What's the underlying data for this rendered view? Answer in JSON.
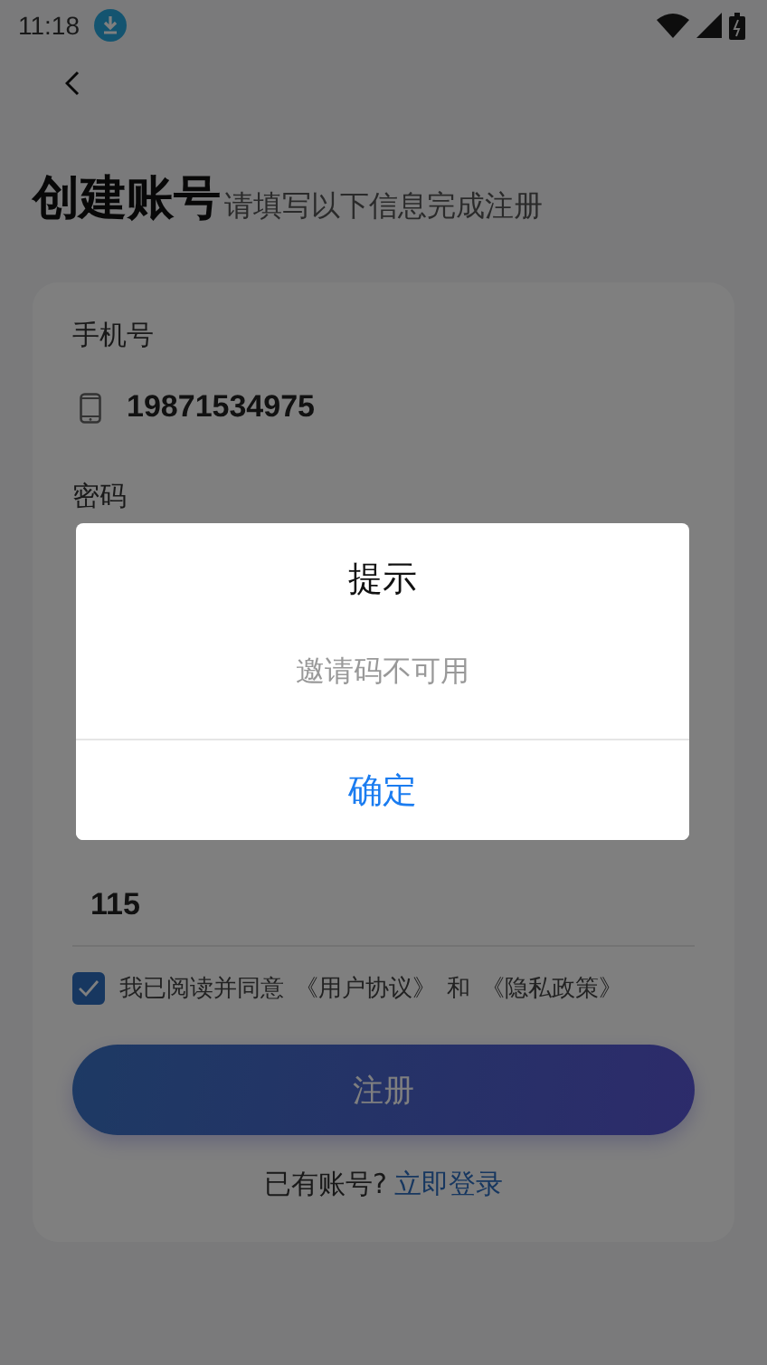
{
  "status_bar": {
    "time": "11:18"
  },
  "header": {
    "title": "创建账号",
    "subtitle": "请填写以下信息完成注册"
  },
  "form": {
    "phone_label": "手机号",
    "phone_value": "19871534975",
    "password_label": "密码",
    "invite_value": "115"
  },
  "agreement": {
    "checked": true,
    "text": "我已阅读并同意",
    "link_1": "《用户协议》",
    "and": "和",
    "link_2": "《隐私政策》"
  },
  "register_button": "注册",
  "login_prompt": {
    "text": "已有账号?",
    "link": "立即登录"
  },
  "dialog": {
    "title": "提示",
    "message": "邀请码不可用",
    "confirm": "确定"
  }
}
